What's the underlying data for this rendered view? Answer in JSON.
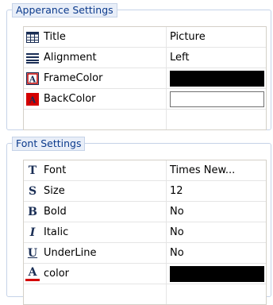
{
  "appearance": {
    "title": "Apperance Settings",
    "rows": [
      {
        "icon": "table-icon",
        "name": "Title",
        "value": "Picture"
      },
      {
        "icon": "align-icon",
        "name": "Alignment",
        "value": "Left"
      },
      {
        "icon": "frame-color-icon",
        "name": "FrameColor",
        "value_color": "#000000"
      },
      {
        "icon": "back-color-icon",
        "name": "BackColor",
        "value_color": "#ffffff"
      }
    ]
  },
  "font": {
    "title": "Font Settings",
    "rows": [
      {
        "icon": "font-icon",
        "glyph": "T",
        "name": "Font",
        "value": "Times New..."
      },
      {
        "icon": "size-icon",
        "glyph": "S",
        "name": "Size",
        "value": "12"
      },
      {
        "icon": "bold-icon",
        "glyph": "B",
        "name": "Bold",
        "value": "No"
      },
      {
        "icon": "italic-icon",
        "glyph": "I",
        "name": "Italic",
        "value": "No"
      },
      {
        "icon": "underline-icon",
        "glyph": "U",
        "name": "UnderLine",
        "value": "No"
      },
      {
        "icon": "font-color-icon",
        "glyph": "A",
        "name": "color",
        "value_color": "#000000"
      }
    ]
  }
}
